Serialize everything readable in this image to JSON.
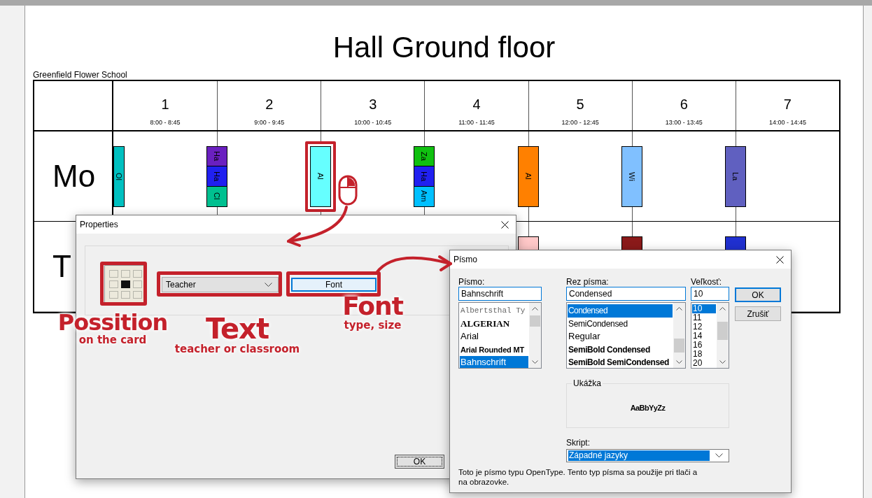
{
  "page": {
    "title": "Hall Ground floor",
    "school": "Greenfield Flower School"
  },
  "timetable": {
    "periods": [
      {
        "number": "1",
        "time": "8:00 - 8:45"
      },
      {
        "number": "2",
        "time": "9:00 - 9:45"
      },
      {
        "number": "3",
        "time": "10:00 - 10:45"
      },
      {
        "number": "4",
        "time": "11:00 - 11:45"
      },
      {
        "number": "5",
        "time": "12:00 - 12:45"
      },
      {
        "number": "6",
        "time": "13:00 - 13:45"
      },
      {
        "number": "7",
        "time": "14:00 - 14:45"
      }
    ],
    "days": [
      {
        "label": "Mo",
        "cards": [
          {
            "highlighted": false,
            "blocks": [
              {
                "label": "Ol",
                "color": "#00c0c0"
              }
            ]
          },
          {
            "highlighted": false,
            "blocks": [
              {
                "label": "Ha",
                "color": "#6a20c0"
              },
              {
                "label": "Ha",
                "color": "#2020f0"
              },
              {
                "label": "Cl",
                "color": "#00c090"
              }
            ]
          },
          {
            "highlighted": true,
            "blocks": [
              {
                "label": "Al",
                "color": "#66ffff"
              }
            ]
          },
          {
            "highlighted": false,
            "blocks": [
              {
                "label": "Za",
                "color": "#10c010"
              },
              {
                "label": "Ha",
                "color": "#2020f0"
              },
              {
                "label": "Am",
                "color": "#00c0ff"
              }
            ]
          },
          {
            "highlighted": false,
            "blocks": [
              {
                "label": "Al",
                "color": "#ff8000"
              }
            ]
          },
          {
            "highlighted": false,
            "blocks": [
              {
                "label": "Wi",
                "color": "#80c0ff"
              }
            ]
          },
          {
            "highlighted": false,
            "blocks": [
              {
                "label": "La",
                "color": "#6060c0"
              }
            ]
          }
        ]
      },
      {
        "label": "T",
        "cards": [
          {
            "highlighted": false,
            "blocks": [
              {
                "color": "#ffc8c8"
              }
            ]
          },
          {
            "highlighted": false,
            "blocks": [
              {
                "color": "#8b1a1a"
              }
            ]
          },
          {
            "highlighted": false,
            "blocks": [
              {
                "color": "#2030d0"
              }
            ]
          }
        ]
      }
    ]
  },
  "properties": {
    "title": "Properties",
    "position_grid": [
      {
        "selected": false
      },
      {
        "selected": false
      },
      {
        "selected": false
      },
      {
        "selected": false
      },
      {
        "selected": true
      },
      {
        "selected": false
      },
      {
        "selected": false
      },
      {
        "selected": false
      },
      {
        "selected": false
      }
    ],
    "text_source": "Teacher",
    "font_button": "Font",
    "ok_button": "OK"
  },
  "font_dialog": {
    "title": "Písmo",
    "font": {
      "label": "Písmo:",
      "value": "Bahnschrift",
      "items": [
        {
          "name": "Albertsthal Ty",
          "kind": "typewriter",
          "selected": false
        },
        {
          "name": "ALGERIAN",
          "kind": "decorative",
          "selected": false
        },
        {
          "name": "Arial",
          "kind": "plain",
          "selected": false
        },
        {
          "name": "Arial Rounded MT",
          "kind": "bold",
          "selected": false
        },
        {
          "name": "Bahnschrift",
          "kind": "plain",
          "selected": true
        }
      ]
    },
    "style": {
      "label": "Rez písma:",
      "value": "Condensed",
      "items": [
        {
          "name": "Condensed",
          "kind": "condensed",
          "selected": true
        },
        {
          "name": "SemiCondensed",
          "kind": "semicondensed",
          "selected": false
        },
        {
          "name": "Regular",
          "kind": "regular",
          "selected": false
        },
        {
          "name": "SemiBold Condensed",
          "kind": "semibold",
          "selected": false
        },
        {
          "name": "SemiBold SemiCondensed",
          "kind": "semibold",
          "selected": false
        }
      ]
    },
    "size": {
      "label": "Veľkosť:",
      "value": "10",
      "items": [
        {
          "name": "10",
          "selected": true
        },
        {
          "name": "11",
          "selected": false
        },
        {
          "name": "12",
          "selected": false
        },
        {
          "name": "14",
          "selected": false
        },
        {
          "name": "16",
          "selected": false
        },
        {
          "name": "18",
          "selected": false
        },
        {
          "name": "20",
          "selected": false
        }
      ]
    },
    "buttons": [
      {
        "label": "OK",
        "default": true
      },
      {
        "label": "Zrušiť",
        "default": false
      }
    ],
    "sample": {
      "label": "Ukážka",
      "text": "AaBbYyZz"
    },
    "script": {
      "label": "Skript:",
      "value": "Západné jazyky"
    },
    "info": "Toto je písmo typu OpenType. Tento typ písma sa použije pri tlači a na obrazovke."
  },
  "annotations": [
    {
      "title": "Possition",
      "note": "on the card"
    },
    {
      "title": "Text",
      "note": "teacher or classroom"
    },
    {
      "title": "Font",
      "note": "type, size"
    }
  ]
}
